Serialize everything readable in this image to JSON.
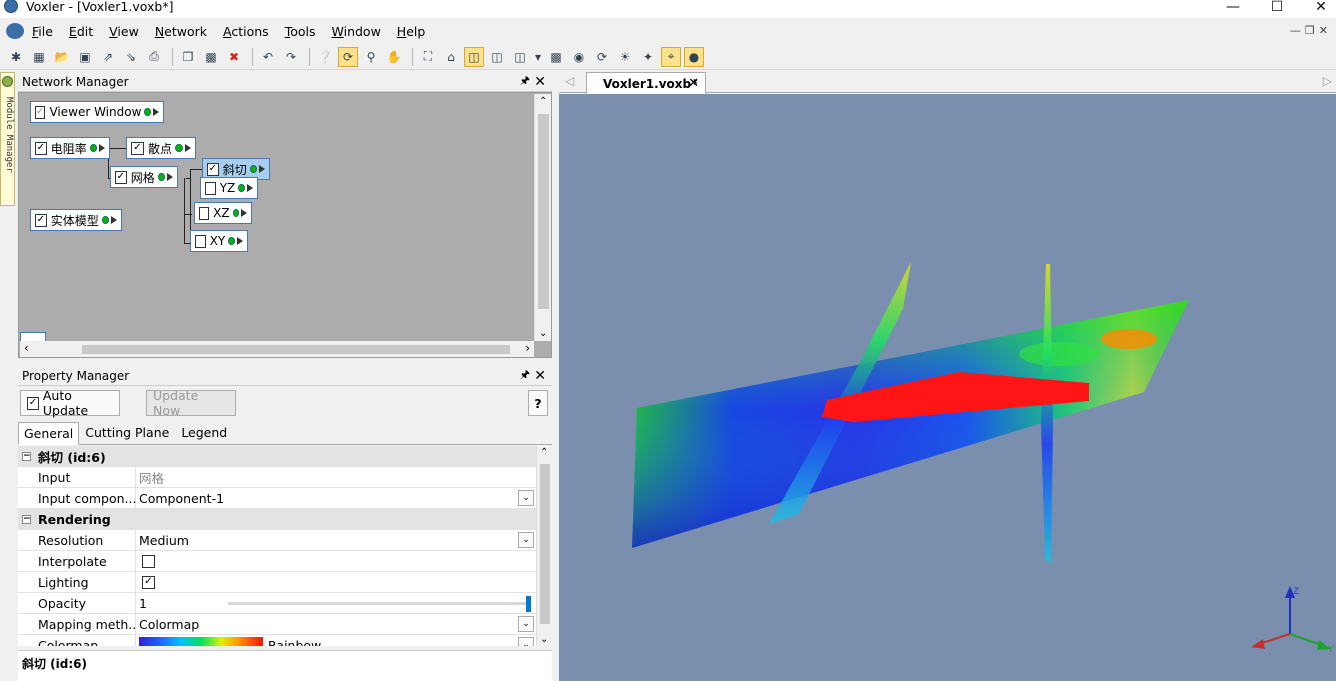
{
  "window": {
    "title": "Voxler - [Voxler1.voxb*]"
  },
  "menu": [
    {
      "label": "File",
      "u": "F",
      "rest": "ile"
    },
    {
      "label": "Edit",
      "u": "E",
      "rest": "dit"
    },
    {
      "label": "View",
      "u": "V",
      "rest": "iew"
    },
    {
      "label": "Network",
      "u": "N",
      "rest": "etwork"
    },
    {
      "label": "Actions",
      "u": "A",
      "rest": "ctions"
    },
    {
      "label": "Tools",
      "u": "T",
      "rest": "ools"
    },
    {
      "label": "Window",
      "u": "W",
      "rest": "indow"
    },
    {
      "label": "Help",
      "u": "H",
      "rest": "elp"
    }
  ],
  "side_tab": {
    "label": "Module Manager"
  },
  "network_manager": {
    "title": "Network Manager",
    "nodes": {
      "viewer": {
        "label": "Viewer Window",
        "checked": true
      },
      "resistivity": {
        "label": "电阻率",
        "checked": true
      },
      "scatter": {
        "label": "散点",
        "checked": true
      },
      "grid": {
        "label": "网格",
        "checked": true
      },
      "oblique": {
        "label": "斜切",
        "checked": true
      },
      "yz": {
        "label": "YZ",
        "checked": false
      },
      "xz": {
        "label": "XZ",
        "checked": false
      },
      "xy": {
        "label": "XY",
        "checked": false
      },
      "solid": {
        "label": "实体模型",
        "checked": true
      }
    }
  },
  "property_manager": {
    "title": "Property Manager",
    "auto_update_label": "Auto Update",
    "auto_update_checked": true,
    "update_now_label": "Update Now",
    "help_label": "?",
    "tabs": [
      "General",
      "Cutting Plane",
      "Legend"
    ],
    "active_tab": "General",
    "section1": "斜切 (id:6)",
    "rows1": [
      {
        "key": "Input",
        "value": "网格"
      },
      {
        "key": "Input compon...",
        "value": "Component-1"
      }
    ],
    "section2": "Rendering",
    "rows2": [
      {
        "key": "Resolution",
        "value": "Medium"
      },
      {
        "key": "Interpolate",
        "value": ""
      },
      {
        "key": "Lighting",
        "value": ""
      },
      {
        "key": "Opacity",
        "value": "1"
      },
      {
        "key": "Mapping meth...",
        "value": "Colormap"
      },
      {
        "key": "Colormap",
        "value": "Rainbow"
      }
    ],
    "interpolate_checked": false,
    "lighting_checked": true,
    "opacity_level": 1.0,
    "status_text": "斜切 (id:6)"
  },
  "document": {
    "tab_label": "Voxler1.voxb*"
  },
  "axes": {
    "z": "Z",
    "y": "Y"
  },
  "colors": {
    "viewport_bg": "#7a8fae",
    "net_bg": "#acacac",
    "accent": "#0078d7",
    "solid_model": "#ff1515"
  }
}
